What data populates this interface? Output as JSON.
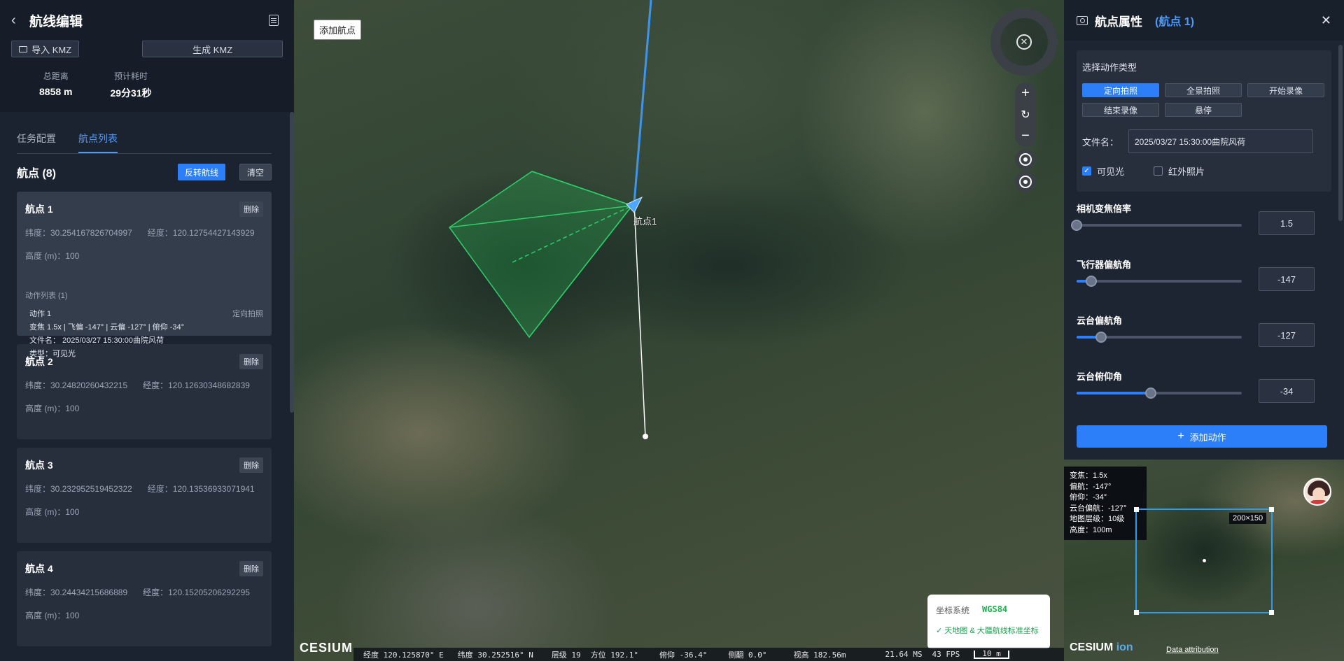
{
  "left": {
    "title": "航线编辑",
    "import_label": "导入 KMZ",
    "generate_label": "生成 KMZ",
    "stats": [
      {
        "label": "总距离",
        "value": "8858 m"
      },
      {
        "label": "预计耗时",
        "value": "29分31秒"
      }
    ],
    "tabs": [
      "任务配置",
      "航点列表"
    ],
    "active_tab": "航点列表",
    "waypoints_title": "航点 (8)",
    "reverse_label": "反转航线",
    "clear_label": "清空",
    "delete_label": "删除",
    "waypoints": [
      {
        "name": "航点 1",
        "lat": "纬度：30.254167826704997",
        "lng": "经度：120.12754427143929",
        "height": "高度 (m)：100",
        "actions_title": "动作列表 (1)",
        "action_name": "动作 1",
        "action_type": "定向拍照",
        "action_params": "变焦 1.5x | 飞偏 -147° | 云偏 -127° | 俯仰 -34°",
        "action_file": "文件名： 2025/03/27 15:30:00曲院风荷",
        "action_kind": "类型：可见光"
      },
      {
        "name": "航点 2",
        "lat": "纬度：30.24820260432215",
        "lng": "经度：120.12630348682839",
        "height": "高度 (m)：100"
      },
      {
        "name": "航点 3",
        "lat": "纬度：30.232952519452322",
        "lng": "经度：120.13536933071941",
        "height": "高度 (m)：100"
      },
      {
        "name": "航点 4",
        "lat": "纬度：30.24434215686889",
        "lng": "经度：120.15205206292295",
        "height": "高度 (m)：100"
      }
    ]
  },
  "map": {
    "add_waypoint_label": "添加航点",
    "waypoint_label": "航点1",
    "coord_system_label": "坐标系统",
    "coord_system_value": "WGS84",
    "coord_note": "✓ 天地图 & 大疆航线标准坐标",
    "cesium_logo": "CESIUM",
    "status": {
      "lng": "经度  120.125870° E",
      "lat": "纬度  30.252516° N",
      "level": "层级  19",
      "heading": "方位  192.1°",
      "pitch": "俯仰  -36.4°",
      "roll": "侧翻  0.0°",
      "distance": "视高  182.56m",
      "ms": "21.64 MS",
      "fps": "43 FPS",
      "scale": "10 m"
    }
  },
  "right": {
    "title": "航点属性",
    "subtitle": "(航点 1)",
    "action_type_title": "选择动作类型",
    "action_types": [
      "定向拍照",
      "全景拍照",
      "开始录像",
      "结束录像",
      "悬停"
    ],
    "active_action": "定向拍照",
    "filename_label": "文件名：",
    "filename_value": "2025/03/27 15:30:00曲院风荷",
    "visible_label": "可见光",
    "infrared_label": "红外照片",
    "visible_checked": true,
    "infrared_checked": false,
    "sliders": [
      {
        "label": "相机变焦倍率",
        "value": "1.5",
        "fraction": 0.0
      },
      {
        "label": "飞行器偏航角",
        "value": "-147",
        "fraction": 0.09
      },
      {
        "label": "云台偏航角",
        "value": "-127",
        "fraction": 0.15
      },
      {
        "label": "云台俯仰角",
        "value": "-34",
        "fraction": 0.45
      }
    ],
    "add_action_label": "添加动作",
    "preview": {
      "info": [
        "变焦：1.5x",
        "偏航：-147°",
        "俯仰：-34°",
        "云台偏航：-127°",
        "地图层级：10级",
        "高度：100m"
      ],
      "frame_size": "200×150",
      "cesium": "CESIUM",
      "ion": "ion",
      "attribution": "Data attribution"
    }
  },
  "colors": {
    "accent": "#2d7ff9",
    "panel": "#1c2330",
    "ok": "#20b050"
  }
}
